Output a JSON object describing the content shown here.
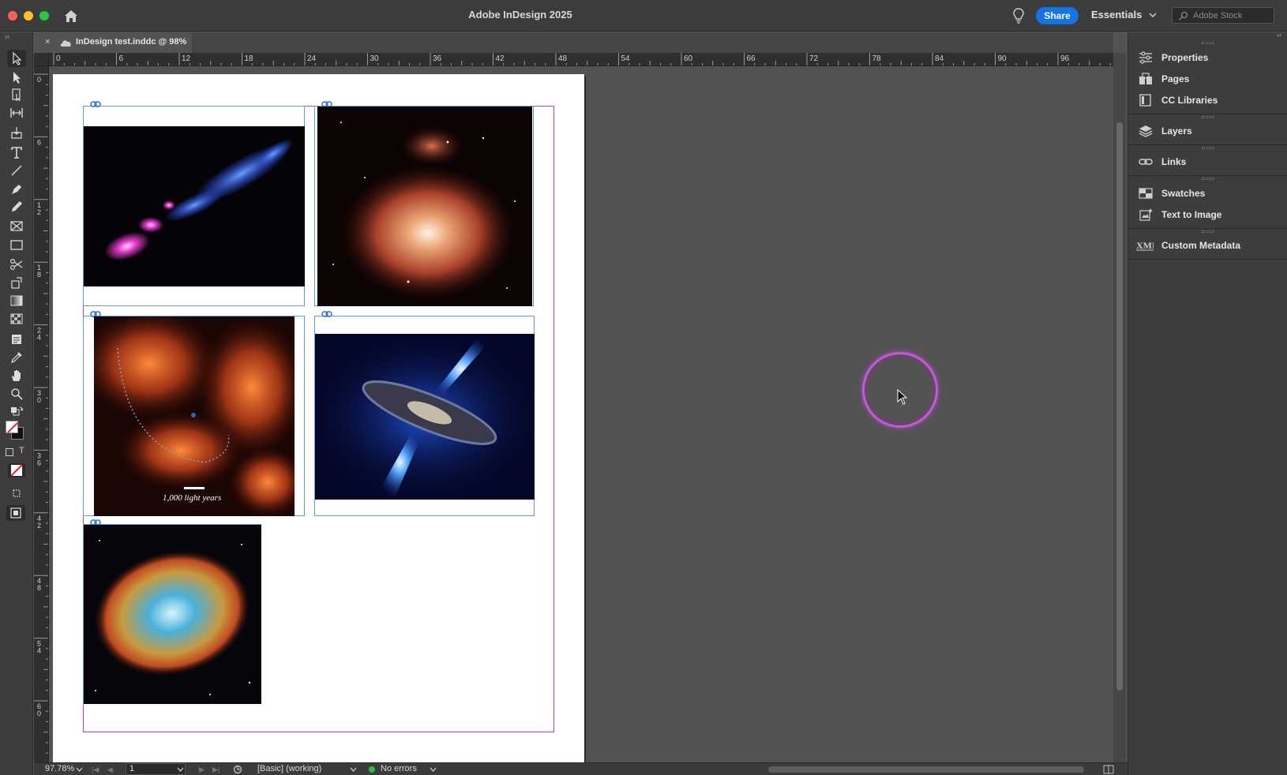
{
  "window": {
    "title": "Adobe InDesign 2025",
    "share_label": "Share",
    "workspace": "Essentials",
    "search_placeholder": "Adobe Stock"
  },
  "tab": {
    "close": "×",
    "label": "InDesign test.inddc @ 98%"
  },
  "ruler": {
    "horizontal": [
      "0",
      "6",
      "12",
      "18",
      "24",
      "30",
      "36",
      "42",
      "48",
      "54",
      "60",
      "66",
      "72",
      "78",
      "84",
      "90",
      "96"
    ],
    "vertical": [
      "0",
      "6",
      "12",
      "18",
      "24",
      "30",
      "36",
      "42",
      "48",
      "54",
      "60"
    ]
  },
  "canvas": {
    "scale_label": "1,000 light years"
  },
  "panel": {
    "items": [
      {
        "label": "Properties",
        "icon": "properties-icon"
      },
      {
        "label": "Pages",
        "icon": "pages-icon"
      },
      {
        "label": "CC Libraries",
        "icon": "cc-libraries-icon"
      },
      {
        "label": "Layers",
        "icon": "layers-icon"
      },
      {
        "label": "Links",
        "icon": "links-icon"
      },
      {
        "label": "Swatches",
        "icon": "swatches-icon"
      },
      {
        "label": "Text to Image",
        "icon": "text-to-image-icon"
      },
      {
        "label": "Custom Metadata",
        "icon": "xmp-icon"
      }
    ]
  },
  "status": {
    "zoom": "97.78%",
    "page": "1",
    "preflight_profile": "[Basic] (working)",
    "errors": "No errors"
  },
  "colors": {
    "accent": "#1473e6",
    "margin_guide": "#c23bc5",
    "frame_edge": "#5a9be0",
    "cursor_ring": "#c459d6",
    "status_ok": "#2dbd45"
  }
}
